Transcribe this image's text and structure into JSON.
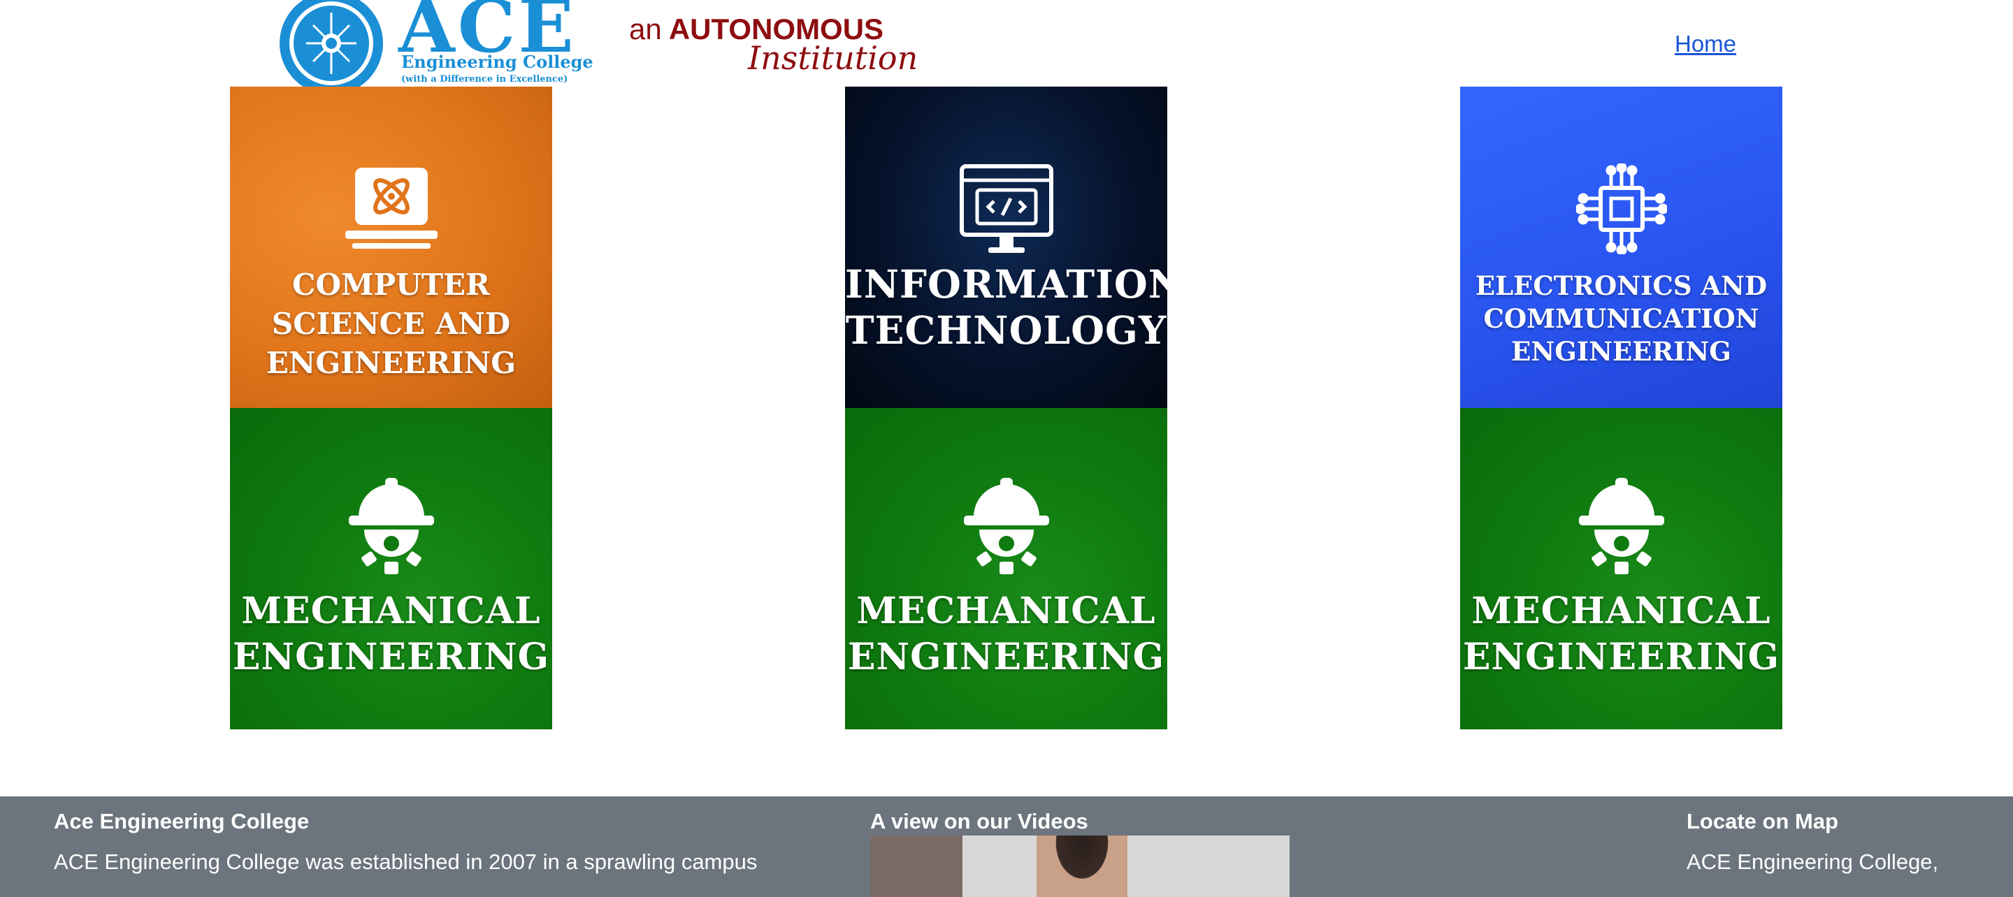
{
  "header": {
    "logo_name": "ACE",
    "logo_college": "Engineering College",
    "logo_tagline": "(with a Difference in Excellence)",
    "autonomous_prefix": "an",
    "autonomous_word": "AUTONOMOUS",
    "institution_word": "Institution",
    "nav_home": "Home"
  },
  "departments": [
    {
      "label_lines": [
        "COMPUTER",
        "SCIENCE AND",
        "ENGINEERING"
      ],
      "icon": "laptop-atom-icon",
      "color": "#e0741a"
    },
    {
      "label_lines": [
        "INFORMATION",
        "TECHNOLOGY"
      ],
      "icon": "monitor-code-icon",
      "color": "#06122b"
    },
    {
      "label_lines": [
        "ELECTRONICS AND",
        "COMMUNICATION",
        "ENGINEERING"
      ],
      "icon": "chip-icon",
      "color": "#2a55f0"
    },
    {
      "label_lines": [
        "MECHANICAL",
        "ENGINEERING"
      ],
      "icon": "helmet-gear-icon",
      "color": "#0f7a0f"
    },
    {
      "label_lines": [
        "MECHANICAL",
        "ENGINEERING"
      ],
      "icon": "helmet-gear-icon",
      "color": "#0f7a0f"
    },
    {
      "label_lines": [
        "MECHANICAL",
        "ENGINEERING"
      ],
      "icon": "helmet-gear-icon",
      "color": "#0f7a0f"
    }
  ],
  "footer": {
    "col1_title": "Ace Engineering College",
    "col1_text": "ACE Engineering College was established in 2007 in a sprawling campus",
    "col2_title": "A view on our Videos",
    "col3_title": "Locate on Map",
    "col3_text": "ACE Engineering College,",
    "background": "#6c757d"
  }
}
